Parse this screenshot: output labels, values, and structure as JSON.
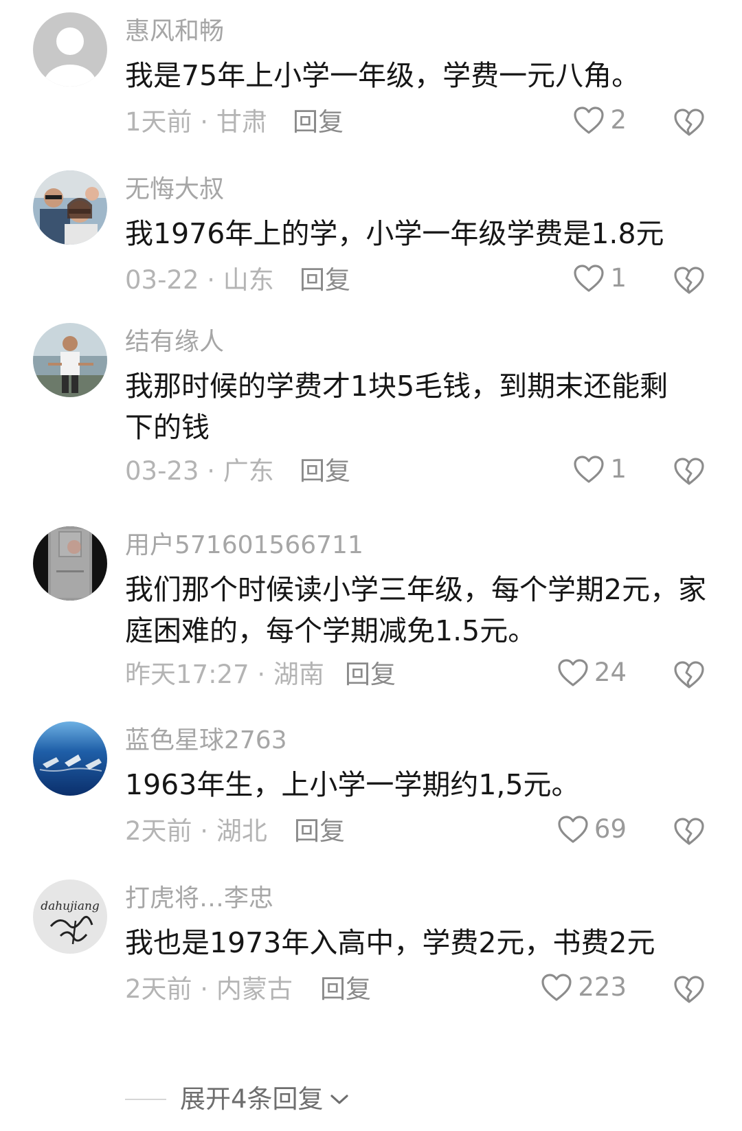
{
  "comments": [
    {
      "username": "惠风和畅",
      "content": "我是75年上小学一年级，学费一元八角。",
      "meta": "1天前 · 甘肃",
      "reply_label": "回复",
      "likes": "2",
      "avatar_icon": "default-avatar-icon"
    },
    {
      "username": "无悔大叔",
      "content": "我1976年上的学，小学一年级学费是1.8元",
      "meta": "03-22 · 山东",
      "reply_label": "回复",
      "likes": "1",
      "avatar_icon": "photo-avatar-icon"
    },
    {
      "username": "结有缘人",
      "content": "我那时候的学费才1块5毛钱，到期末还能剩下的钱",
      "meta": "03-23 · 广东",
      "reply_label": "回复",
      "likes": "1",
      "avatar_icon": "photo-avatar-icon"
    },
    {
      "username": "用户571601566711",
      "content": "我们那个时候读小学三年级，每个学期2元，家庭困难的，每个学期减免1.5元。",
      "meta": "昨天17:27 · 湖南",
      "reply_label": "回复",
      "likes": "24",
      "avatar_icon": "photo-avatar-icon"
    },
    {
      "username": "蓝色星球2763",
      "content": "1963年生，上小学一学期约1,5元。",
      "meta": "2天前 · 湖北",
      "reply_label": "回复",
      "likes": "69",
      "avatar_icon": "photo-avatar-icon"
    },
    {
      "username": "打虎将…李忠",
      "content": "我也是1973年入高中，学费2元，书费2元",
      "meta": "2天前 · 内蒙古",
      "reply_label": "回复",
      "likes": "223",
      "avatar_icon": "signature-avatar-icon",
      "avatar_signature_text": "dahujiang"
    }
  ],
  "expand": {
    "label": "展开4条回复"
  },
  "colors": {
    "like_icon": "#8c8c8c",
    "username": "#a6a6a6",
    "content": "#161616"
  }
}
